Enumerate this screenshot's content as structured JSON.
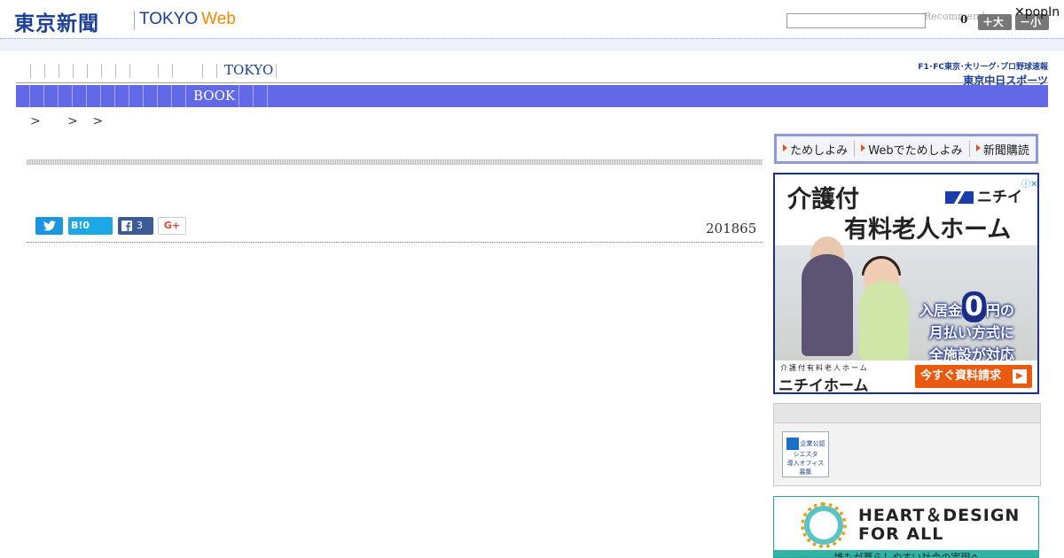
{
  "header": {
    "logo_jp": "東京新聞",
    "logo_en": "TOKYO",
    "logo_web": "Web",
    "recommend": "Recommend",
    "count": "0",
    "font_large": "＋大",
    "font_small": "－小",
    "popin": "✕popIn"
  },
  "nav": {
    "tokyo": "TOKYO",
    "sports_line1": "F1･FC東京･大リーグ･プロ野球速報",
    "sports_line2": "東京中日スポーツ",
    "book": "BOOK"
  },
  "breadcrumb": ">　 > >",
  "article": {
    "date": "201865"
  },
  "share": {
    "hatena_label": "B!",
    "hatena_count": "0",
    "facebook_count": "3",
    "google_label": "G+"
  },
  "sidebar": {
    "trial": [
      "ためしよみ",
      "Webでためしよみ",
      "新聞購読"
    ],
    "ad": {
      "title1": "介護付",
      "title2": "有料老人ホーム",
      "brand": "ニチイ",
      "offer1": "入居金",
      "offer_big": "0",
      "offer1b": "円の",
      "offer2": "月払い方式に",
      "offer3": "全施設が対応",
      "small": "介護付有料老人ホーム",
      "home": "ニチイホーム",
      "cta": "今すぐ資料請求"
    },
    "badge_text": [
      "企業公認",
      "シエスタ",
      "導入オフィス",
      "募集"
    ],
    "hdfa": {
      "line1": "HEART＆DESIGN",
      "line2": "FOR ALL",
      "band": "誰もが暮らしやすい社会の実現へ"
    }
  },
  "colors": {
    "brand_blue": "#1c3f94",
    "nav_bar": "#6269e6",
    "web_orange": "#f08a00",
    "cta_orange": "#e85a10"
  }
}
